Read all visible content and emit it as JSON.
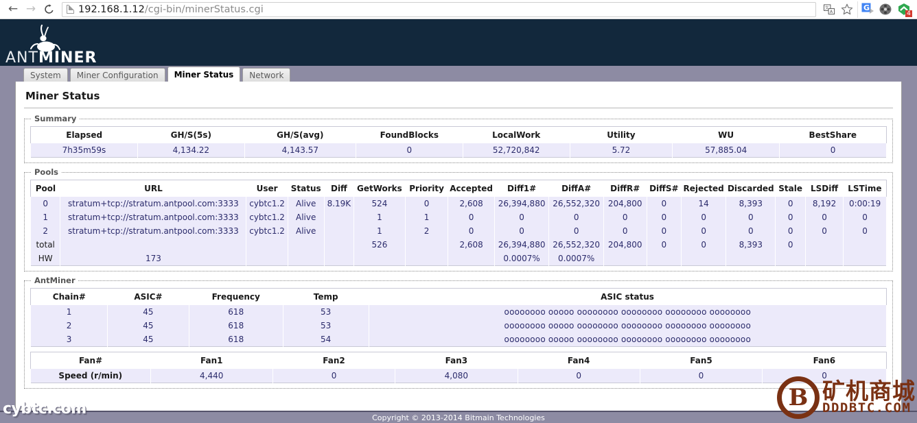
{
  "browser": {
    "back_icon": "back-arrow-icon",
    "forward_icon": "forward-arrow-icon",
    "reload_icon": "reload-icon",
    "url_host": "192.168.1.12",
    "url_path": "/cgi-bin/minerStatus.cgi",
    "translate_icon": "translate-icon",
    "bookmark_icon": "star-icon",
    "google_translate_ext_icon": "google-translate-extension-icon",
    "film_reel_ext_icon": "film-reel-extension-icon",
    "green_shield_ext_icon": "green-shield-extension-icon",
    "green_shield_badge": "4"
  },
  "brand": {
    "name_light": "ANT",
    "name_bold": "MINER",
    "logo_icon": "antminer-ant-logo"
  },
  "tabs": [
    {
      "label": "System",
      "active": false
    },
    {
      "label": "Miner Configuration",
      "active": false
    },
    {
      "label": "Miner Status",
      "active": true
    },
    {
      "label": "Network",
      "active": false
    }
  ],
  "page": {
    "title": "Miner Status"
  },
  "summary": {
    "legend": "Summary",
    "headers": [
      "Elapsed",
      "GH/S(5s)",
      "GH/S(avg)",
      "FoundBlocks",
      "LocalWork",
      "Utility",
      "WU",
      "BestShare"
    ],
    "row": [
      "7h35m59s",
      "4,134.22",
      "4,143.57",
      "0",
      "52,720,842",
      "5.72",
      "57,885.04",
      "0"
    ]
  },
  "pools": {
    "legend": "Pools",
    "headers": [
      "Pool",
      "URL",
      "User",
      "Status",
      "Diff",
      "GetWorks",
      "Priority",
      "Accepted",
      "Diff1#",
      "DiffA#",
      "DiffR#",
      "DiffS#",
      "Rejected",
      "Discarded",
      "Stale",
      "LSDiff",
      "LSTime"
    ],
    "rows": [
      [
        "0",
        "stratum+tcp://stratum.antpool.com:3333",
        "cybtc1.2",
        "Alive",
        "8.19K",
        "524",
        "0",
        "2,608",
        "26,394,880",
        "26,552,320",
        "204,800",
        "0",
        "14",
        "8,393",
        "0",
        "8,192",
        "0:00:19"
      ],
      [
        "1",
        "stratum+tcp://stratum.antpool.com:3333",
        "cybtc1.2",
        "Alive",
        "",
        "1",
        "1",
        "0",
        "0",
        "0",
        "0",
        "0",
        "0",
        "0",
        "0",
        "0",
        "0"
      ],
      [
        "2",
        "stratum+tcp://stratum.antpool.com:3333",
        "cybtc1.2",
        "Alive",
        "",
        "1",
        "2",
        "0",
        "0",
        "0",
        "0",
        "0",
        "0",
        "0",
        "0",
        "0",
        "0"
      ],
      [
        "total",
        "",
        "",
        "",
        "",
        "526",
        "",
        "2,608",
        "26,394,880",
        "26,552,320",
        "204,800",
        "0",
        "0",
        "8,393",
        "0",
        "",
        ""
      ],
      [
        "HW",
        "173",
        "",
        "",
        "",
        "",
        "",
        "",
        "0.0007%",
        "0.0007%",
        "",
        "",
        "",
        "",
        "",
        "",
        ""
      ]
    ]
  },
  "antminer": {
    "legend": "AntMiner",
    "headers": [
      "Chain#",
      "ASIC#",
      "Frequency",
      "Temp",
      "ASIC status"
    ],
    "rows": [
      [
        "1",
        "45",
        "618",
        "53",
        "oooooooo ooooo oooooooo oooooooo oooooooo oooooooo"
      ],
      [
        "2",
        "45",
        "618",
        "53",
        "oooooooo ooooo oooooooo oooooooo oooooooo oooooooo"
      ],
      [
        "3",
        "45",
        "618",
        "54",
        "oooooooo ooooo oooooooo oooooooo oooooooo oooooooo"
      ]
    ]
  },
  "fans": {
    "headers": [
      "Fan#",
      "Fan1",
      "Fan2",
      "Fan3",
      "Fan4",
      "Fan5",
      "Fan6"
    ],
    "row_label": "Speed (r/min)",
    "values": [
      "4,440",
      "0",
      "4,080",
      "0",
      "0",
      "0"
    ]
  },
  "footer": {
    "copyright": "Copyright © 2013-2014  Bitmain Technologies"
  },
  "watermarks": {
    "left": "cybtc.com",
    "right_symbol": "B",
    "right_cn": "矿机商城",
    "right_en": "DDDBTC.COM"
  }
}
